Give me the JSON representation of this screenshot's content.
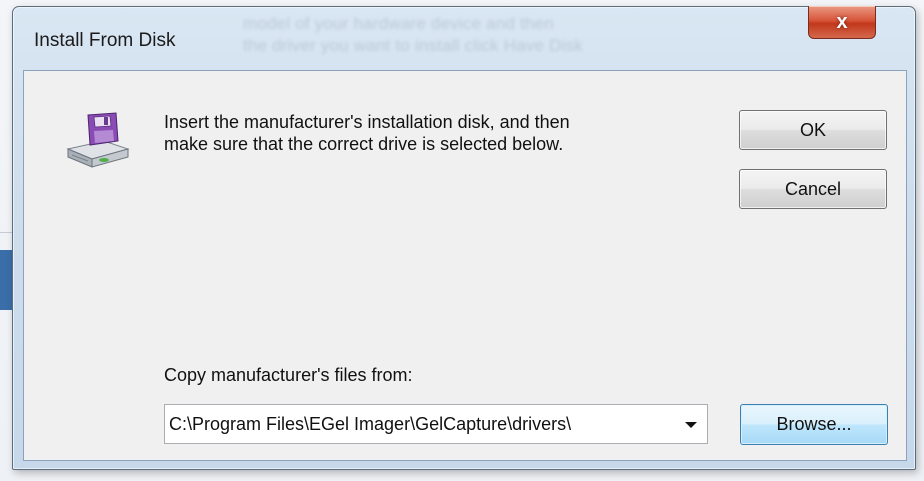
{
  "dialog": {
    "title": "Install From Disk",
    "close_glyph": "x",
    "background_text": "model of your hardware device and then\nthe driver you want to install click Have Disk",
    "message": "Insert the manufacturer's installation disk, and then\nmake sure that the correct drive is selected below.",
    "copy_label": "Copy manufacturer's files from:",
    "path_value": "C:\\Program Files\\EGel Imager\\GelCapture\\drivers\\",
    "buttons": {
      "ok": "OK",
      "cancel": "Cancel",
      "browse": "Browse..."
    },
    "icons": {
      "disk": "floppy-disk-drive-icon",
      "dropdown": "chevron-down-icon",
      "close": "close-icon"
    }
  },
  "colors": {
    "title_bar": "#cfdeed",
    "client_background": "#f0f0f0",
    "close_button": "#c2381c",
    "browse_highlight": "#bee6fd",
    "disk_purple": "#8a4bb5"
  }
}
